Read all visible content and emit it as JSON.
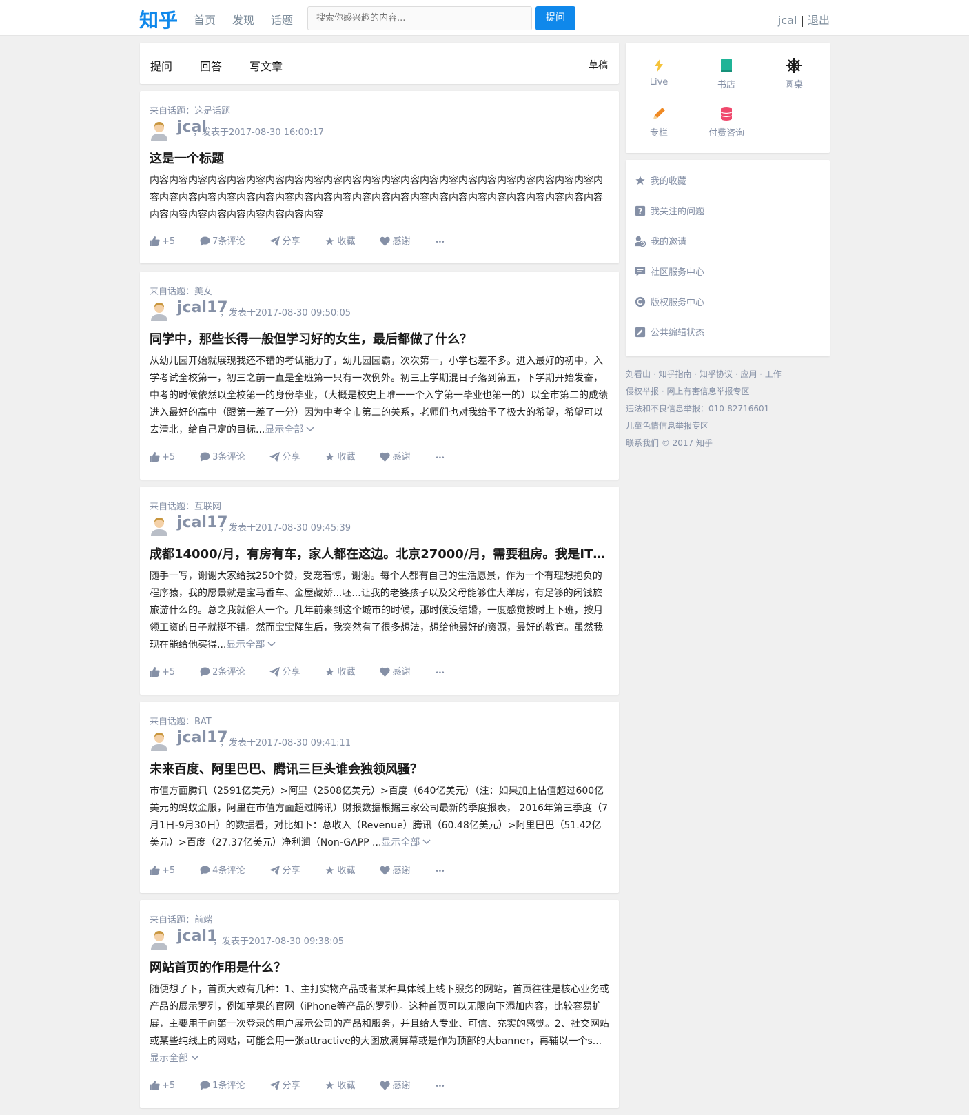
{
  "header": {
    "logo": "知乎",
    "nav": [
      "首页",
      "发现",
      "话题"
    ],
    "search_placeholder": "搜索你感兴趣的内容...",
    "ask_button": "提问",
    "username": "jcal",
    "separator": "|",
    "logout": "退出"
  },
  "actionbar": {
    "ask": "提问",
    "answer": "回答",
    "write": "写文章",
    "drafts": "草稿"
  },
  "feed": [
    {
      "topic": "来自话题：这是话题",
      "author": "jcal",
      "date": "，发表于2017-08-30 16:00:17",
      "title": "这是一个标题",
      "content": "内容内容内容内容内容内容内容内容内容内容内容内容内容内容内容内容内容内容内容内容内容内容内容内容内容内容内容内容内容内容内容内容内容内容内容内容内容内容内容内容内容内容内容内容内容内容内容内容内容内容内容内容内容内容内容内容",
      "show_all": "",
      "likes": "+5",
      "comments": "7条评论"
    },
    {
      "topic": "来自话题：美女",
      "author": "jcal17",
      "date": "，发表于2017-08-30 09:50:05",
      "title": "同学中，那些长得一般但学习好的女生，最后都做了什么？",
      "content": "从幼儿园开始就展现我还不错的考试能力了，幼儿园园霸，次次第一，小学也差不多。进入最好的初中，入学考试全校第一，初三之前一直是全班第一只有一次例外。初三上学期混日子落到第五，下学期开始发奋，中考的时候依然以全校第一的身份毕业，（大概是校史上唯一一个入学第一毕业也第一的）以全市第二的成绩进入最好的高中（跟第一差了一分）因为中考全市第二的关系，老师们也对我给予了极大的希望，希望可以去清北，给自己定的目标...",
      "show_all": "显示全部",
      "likes": "+5",
      "comments": "3条评论"
    },
    {
      "topic": "来自话题：互联网",
      "author": "jcal17",
      "date": "，发表于2017-08-30 09:45:39",
      "title": "成都14000/月，有房有车，家人都在这边。北京27000/月，需要租房。我是IT行...",
      "content": "随手一写，谢谢大家给我250个赞，受宠若惊，谢谢。每个人都有自己的生活愿景，作为一个有理想抱负的程序猿，我的愿景就是宝马香车、金屋藏娇...呸...让我的老婆孩子以及父母能够住大洋房，有足够的闲钱旅旅游什么的。总之我就俗人一个。几年前来到这个城市的时候，那时候没结婚，一度感觉按时上下班，按月领工资的日子就挺不错。然而宝宝降生后，我突然有了很多想法，想给他最好的资源，最好的教育。虽然我现在能给他买得...",
      "show_all": "显示全部",
      "likes": "+5",
      "comments": "2条评论"
    },
    {
      "topic": "来自话题：BAT",
      "author": "jcal17",
      "date": "，发表于2017-08-30 09:41:11",
      "title": "未来百度、阿里巴巴、腾讯三巨头谁会独领风骚？",
      "content": "市值方面腾讯（2591亿美元）>阿里（2508亿美元）>百度（640亿美元）（注：如果加上估值超过600亿美元的蚂蚁金服，阿里在市值方面超过腾讯）财报数据根据三家公司最新的季度报表， 2016年第三季度（7月1日-9月30日）的数据看，对比如下：总收入（Revenue）腾讯（60.48亿美元）>阿里巴巴（51.42亿美元）>百度（27.37亿美元）净利润（Non-GAPP ...",
      "show_all": "显示全部",
      "likes": "+5",
      "comments": "4条评论"
    },
    {
      "topic": "来自话题：前端",
      "author": "jcal1",
      "date": "，发表于2017-08-30 09:38:05",
      "title": "网站首页的作用是什么？",
      "content": "随便想了下，首页大致有几种：1、主打实物产品或者某种具体线上线下服务的网站，首页往往是核心业务或产品的展示罗列，例如苹果的官网（iPhone等产品的罗列）。这种首页可以无限向下添加内容，比较容易扩展，主要用于向第一次登录的用户展示公司的产品和服务，并且给人专业、可信、充实的感觉。2、社交网站或某些纯线上的网站，可能会用一张attractive的大图放满屏幕或是作为顶部的大banner，再辅以一个s...",
      "show_all": "显示全部",
      "likes": "+5",
      "comments": "1条评论"
    }
  ],
  "actions": {
    "share": "分享",
    "collect": "收藏",
    "thanks": "感谢",
    "more": "•••"
  },
  "sidebar": {
    "icons": [
      {
        "label": "Live",
        "icon": "lightning-icon",
        "color": "#f5c33b"
      },
      {
        "label": "书店",
        "icon": "book-icon",
        "color": "#1fb497"
      },
      {
        "label": "圆桌",
        "icon": "wheel-icon",
        "color": "#1a1a1a"
      },
      {
        "label": "专栏",
        "icon": "pencil-icon",
        "color": "#f08a24"
      },
      {
        "label": "付费咨询",
        "icon": "coins-icon",
        "color": "#f0486c"
      }
    ],
    "links": [
      {
        "label": "我的收藏",
        "icon": "star-icon"
      },
      {
        "label": "我关注的问题",
        "icon": "question-icon"
      },
      {
        "label": "我的邀请",
        "icon": "invite-icon"
      },
      {
        "label": "社区服务中心",
        "icon": "community-icon"
      },
      {
        "label": "版权服务中心",
        "icon": "copyright-icon"
      },
      {
        "label": "公共编辑状态",
        "icon": "edit-icon"
      }
    ]
  },
  "footer": {
    "line1": "刘看山 · 知乎指南 · 知乎协议 · 应用 · 工作",
    "line2": "侵权举报 · 网上有害信息举报专区",
    "line3": "违法和不良信息举报：010-82716601",
    "line4": "儿童色情信息举报专区",
    "line5": "联系我们 © 2017 知乎"
  },
  "colors": {
    "brand": "#0f88eb",
    "muted": "#8590a6",
    "background": "#f0f0f0"
  }
}
